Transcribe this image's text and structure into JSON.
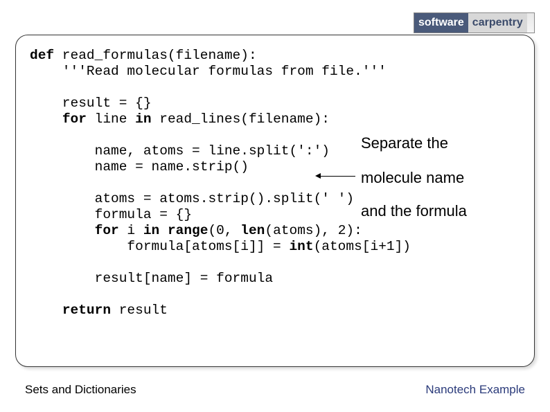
{
  "logo": {
    "left": "software",
    "right": "carpentry"
  },
  "code": {
    "l1a": "def",
    "l1b": " read_formulas(filename):",
    "l2": "    '''Read molecular formulas from file.'''",
    "l3": "",
    "l4": "    result = {}",
    "l5a": "    ",
    "l5b": "for",
    "l5c": " line ",
    "l5d": "in",
    "l5e": " read_lines(filename):",
    "l6": "",
    "l7": "        name, atoms = line.split(':')",
    "l8": "        name = name.strip()",
    "l9": "",
    "l10": "        atoms = atoms.strip().split(' ')",
    "l11": "        formula = {}",
    "l12a": "        ",
    "l12b": "for",
    "l12c": " i ",
    "l12d": "in",
    "l12e": " ",
    "l12f": "range",
    "l12g": "(0, ",
    "l12h": "len",
    "l12i": "(atoms), 2):",
    "l13a": "            formula[atoms[i]] = ",
    "l13b": "int",
    "l13c": "(atoms[i+1])",
    "l14": "",
    "l15": "        result[name] = formula",
    "l16": "",
    "l17a": "    ",
    "l17b": "return",
    "l17c": " result"
  },
  "annotation": {
    "line1": "Separate the",
    "line2": "molecule name",
    "line3": "and the formula"
  },
  "footer": {
    "left": "Sets and Dictionaries",
    "right": "Nanotech Example"
  }
}
